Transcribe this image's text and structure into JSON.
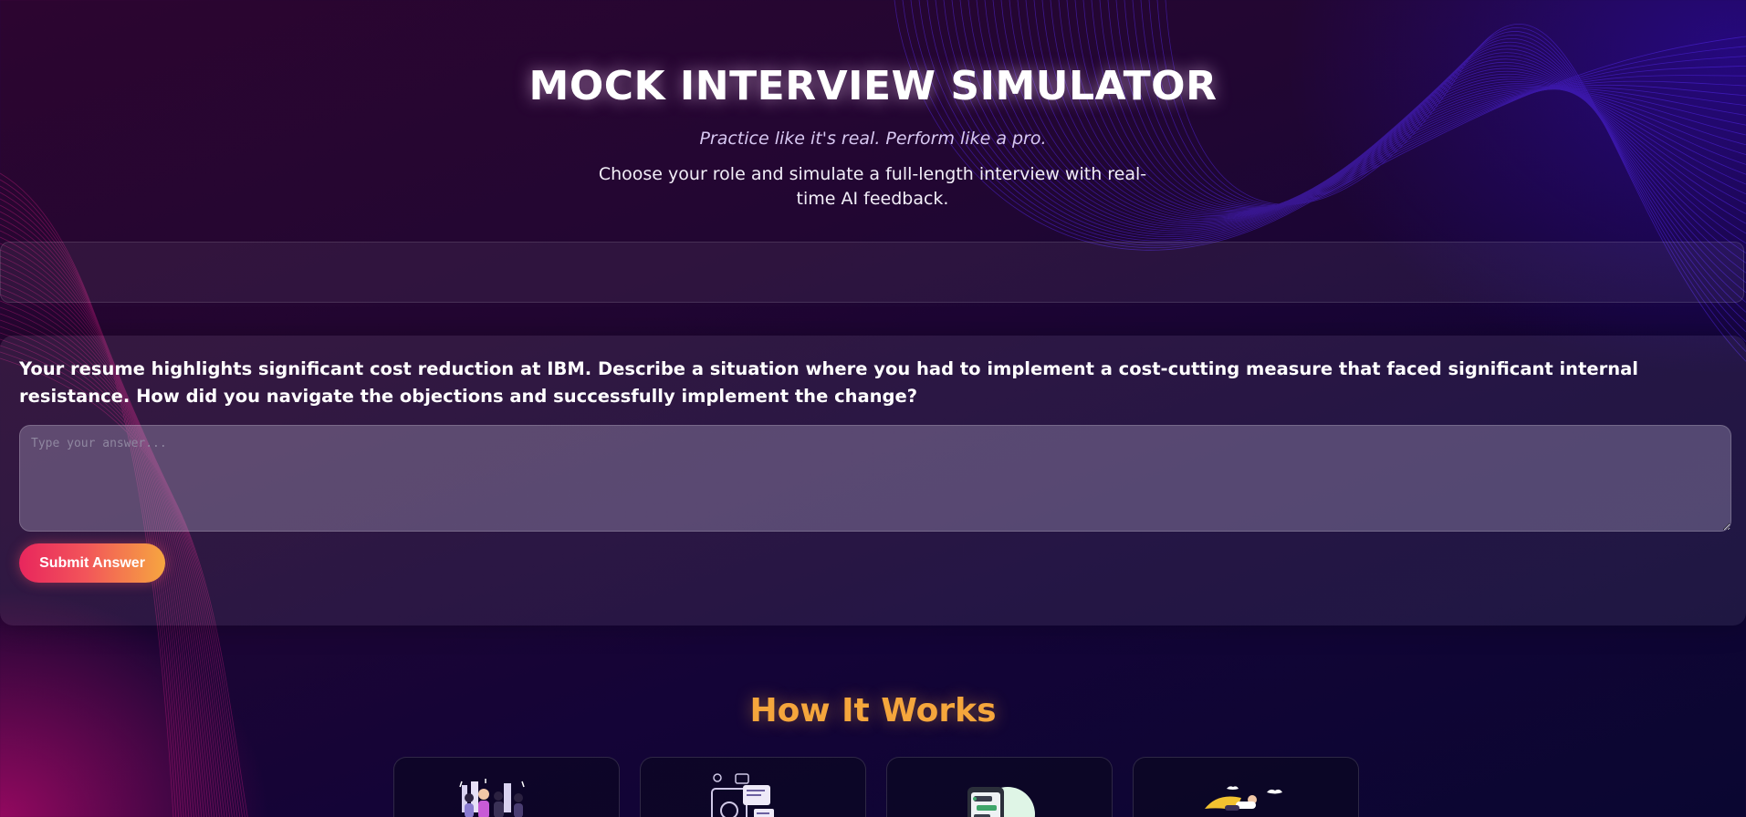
{
  "hero": {
    "title": "MOCK INTERVIEW SIMULATOR",
    "tagline": "Practice like it's real. Perform like a pro.",
    "description": "Choose your role and simulate a full-length interview with real-time AI feedback."
  },
  "interview": {
    "question": "Your resume highlights significant cost reduction at IBM. Describe a situation where you had to implement a cost-cutting measure that faced significant internal resistance. How did you navigate the objections and successfully implement the change?",
    "answer_value": "",
    "answer_placeholder": "Type your answer...",
    "submit_label": "Submit Answer"
  },
  "how_it_works": {
    "title": "How It Works",
    "steps": [
      {
        "icon": "team-illustration-icon"
      },
      {
        "icon": "documents-illustration-icon"
      },
      {
        "icon": "phone-chat-illustration-icon"
      },
      {
        "icon": "superhero-flying-illustration-icon"
      }
    ]
  },
  "colors": {
    "accent_orange": "#f5a63c",
    "button_gradient_start": "#e8265d",
    "button_gradient_end": "#f6a640",
    "background_dark": "#140437"
  }
}
